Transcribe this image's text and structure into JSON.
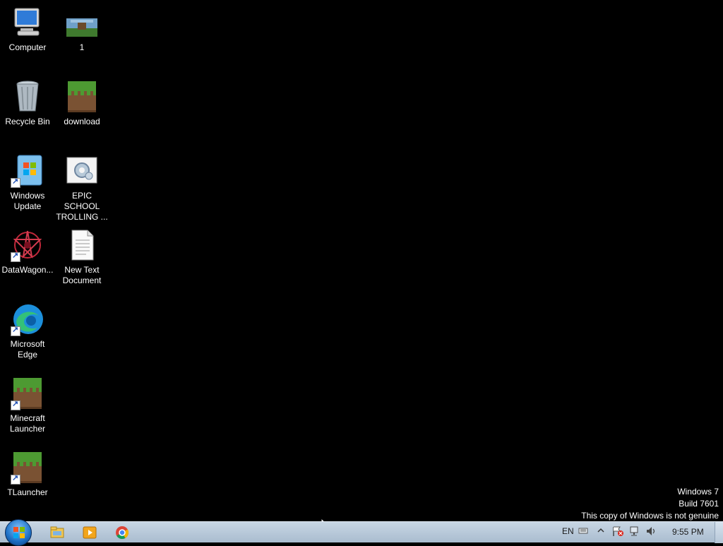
{
  "desktop": {
    "icons": [
      {
        "label": "Computer"
      },
      {
        "label": "1"
      },
      {
        "label": "Recycle Bin"
      },
      {
        "label": "download"
      },
      {
        "label": "Windows\nUpdate"
      },
      {
        "label": "EPIC SCHOOL\nTROLLING ..."
      },
      {
        "label": "DataWagon..."
      },
      {
        "label": "New Text\nDocument"
      },
      {
        "label": "Microsoft\nEdge"
      },
      {
        "label": "Minecraft\nLauncher"
      },
      {
        "label": "TLauncher"
      }
    ]
  },
  "watermark": {
    "line1": "Windows 7",
    "line2": "Build 7601",
    "line3": "This copy of Windows is not genuine"
  },
  "taskbar": {
    "pinned": [
      {
        "icon": "file-explorer-icon"
      },
      {
        "icon": "media-player-icon"
      },
      {
        "icon": "chrome-icon"
      }
    ],
    "tray": {
      "language": "EN",
      "clock": "9:55 PM"
    }
  }
}
